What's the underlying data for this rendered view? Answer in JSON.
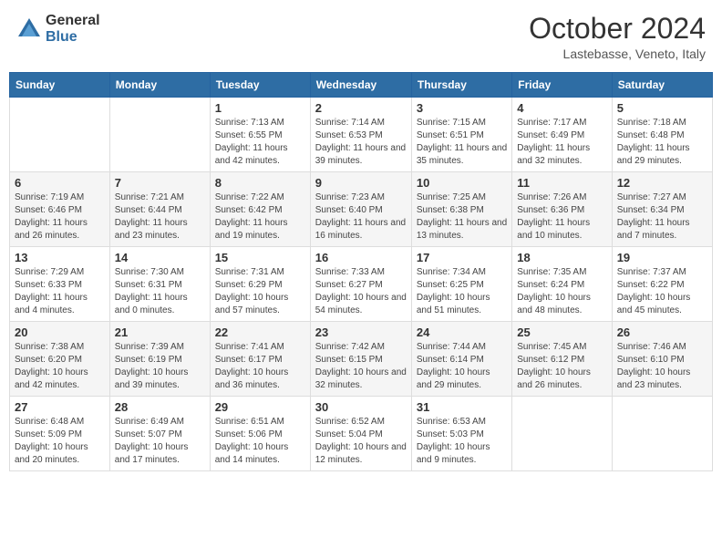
{
  "header": {
    "logo_general": "General",
    "logo_blue": "Blue",
    "title": "October 2024",
    "location": "Lastebasse, Veneto, Italy"
  },
  "weekdays": [
    "Sunday",
    "Monday",
    "Tuesday",
    "Wednesday",
    "Thursday",
    "Friday",
    "Saturday"
  ],
  "weeks": [
    [
      {
        "day": "",
        "info": ""
      },
      {
        "day": "",
        "info": ""
      },
      {
        "day": "1",
        "info": "Sunrise: 7:13 AM\nSunset: 6:55 PM\nDaylight: 11 hours and 42 minutes."
      },
      {
        "day": "2",
        "info": "Sunrise: 7:14 AM\nSunset: 6:53 PM\nDaylight: 11 hours and 39 minutes."
      },
      {
        "day": "3",
        "info": "Sunrise: 7:15 AM\nSunset: 6:51 PM\nDaylight: 11 hours and 35 minutes."
      },
      {
        "day": "4",
        "info": "Sunrise: 7:17 AM\nSunset: 6:49 PM\nDaylight: 11 hours and 32 minutes."
      },
      {
        "day": "5",
        "info": "Sunrise: 7:18 AM\nSunset: 6:48 PM\nDaylight: 11 hours and 29 minutes."
      }
    ],
    [
      {
        "day": "6",
        "info": "Sunrise: 7:19 AM\nSunset: 6:46 PM\nDaylight: 11 hours and 26 minutes."
      },
      {
        "day": "7",
        "info": "Sunrise: 7:21 AM\nSunset: 6:44 PM\nDaylight: 11 hours and 23 minutes."
      },
      {
        "day": "8",
        "info": "Sunrise: 7:22 AM\nSunset: 6:42 PM\nDaylight: 11 hours and 19 minutes."
      },
      {
        "day": "9",
        "info": "Sunrise: 7:23 AM\nSunset: 6:40 PM\nDaylight: 11 hours and 16 minutes."
      },
      {
        "day": "10",
        "info": "Sunrise: 7:25 AM\nSunset: 6:38 PM\nDaylight: 11 hours and 13 minutes."
      },
      {
        "day": "11",
        "info": "Sunrise: 7:26 AM\nSunset: 6:36 PM\nDaylight: 11 hours and 10 minutes."
      },
      {
        "day": "12",
        "info": "Sunrise: 7:27 AM\nSunset: 6:34 PM\nDaylight: 11 hours and 7 minutes."
      }
    ],
    [
      {
        "day": "13",
        "info": "Sunrise: 7:29 AM\nSunset: 6:33 PM\nDaylight: 11 hours and 4 minutes."
      },
      {
        "day": "14",
        "info": "Sunrise: 7:30 AM\nSunset: 6:31 PM\nDaylight: 11 hours and 0 minutes."
      },
      {
        "day": "15",
        "info": "Sunrise: 7:31 AM\nSunset: 6:29 PM\nDaylight: 10 hours and 57 minutes."
      },
      {
        "day": "16",
        "info": "Sunrise: 7:33 AM\nSunset: 6:27 PM\nDaylight: 10 hours and 54 minutes."
      },
      {
        "day": "17",
        "info": "Sunrise: 7:34 AM\nSunset: 6:25 PM\nDaylight: 10 hours and 51 minutes."
      },
      {
        "day": "18",
        "info": "Sunrise: 7:35 AM\nSunset: 6:24 PM\nDaylight: 10 hours and 48 minutes."
      },
      {
        "day": "19",
        "info": "Sunrise: 7:37 AM\nSunset: 6:22 PM\nDaylight: 10 hours and 45 minutes."
      }
    ],
    [
      {
        "day": "20",
        "info": "Sunrise: 7:38 AM\nSunset: 6:20 PM\nDaylight: 10 hours and 42 minutes."
      },
      {
        "day": "21",
        "info": "Sunrise: 7:39 AM\nSunset: 6:19 PM\nDaylight: 10 hours and 39 minutes."
      },
      {
        "day": "22",
        "info": "Sunrise: 7:41 AM\nSunset: 6:17 PM\nDaylight: 10 hours and 36 minutes."
      },
      {
        "day": "23",
        "info": "Sunrise: 7:42 AM\nSunset: 6:15 PM\nDaylight: 10 hours and 32 minutes."
      },
      {
        "day": "24",
        "info": "Sunrise: 7:44 AM\nSunset: 6:14 PM\nDaylight: 10 hours and 29 minutes."
      },
      {
        "day": "25",
        "info": "Sunrise: 7:45 AM\nSunset: 6:12 PM\nDaylight: 10 hours and 26 minutes."
      },
      {
        "day": "26",
        "info": "Sunrise: 7:46 AM\nSunset: 6:10 PM\nDaylight: 10 hours and 23 minutes."
      }
    ],
    [
      {
        "day": "27",
        "info": "Sunrise: 6:48 AM\nSunset: 5:09 PM\nDaylight: 10 hours and 20 minutes."
      },
      {
        "day": "28",
        "info": "Sunrise: 6:49 AM\nSunset: 5:07 PM\nDaylight: 10 hours and 17 minutes."
      },
      {
        "day": "29",
        "info": "Sunrise: 6:51 AM\nSunset: 5:06 PM\nDaylight: 10 hours and 14 minutes."
      },
      {
        "day": "30",
        "info": "Sunrise: 6:52 AM\nSunset: 5:04 PM\nDaylight: 10 hours and 12 minutes."
      },
      {
        "day": "31",
        "info": "Sunrise: 6:53 AM\nSunset: 5:03 PM\nDaylight: 10 hours and 9 minutes."
      },
      {
        "day": "",
        "info": ""
      },
      {
        "day": "",
        "info": ""
      }
    ]
  ]
}
